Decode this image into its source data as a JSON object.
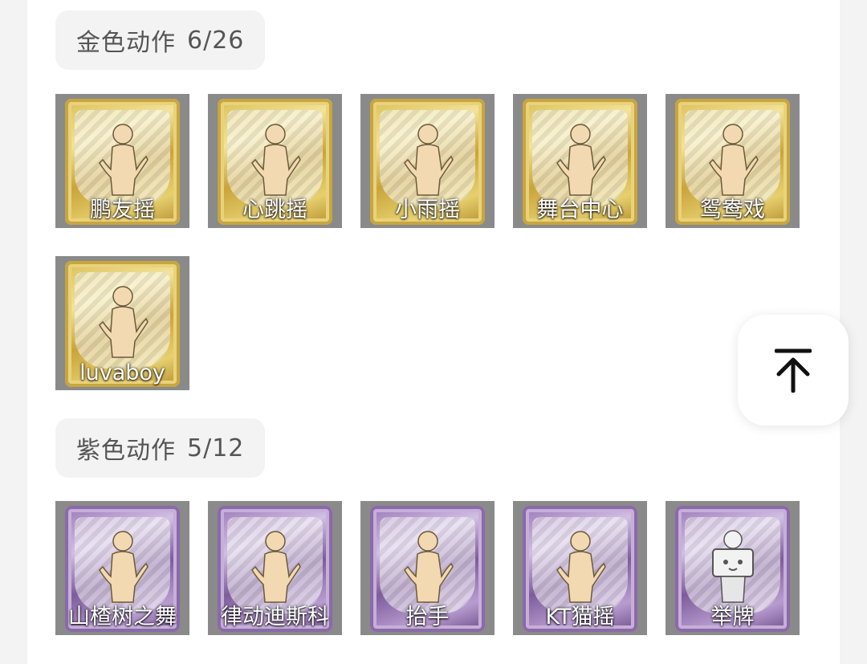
{
  "sections": [
    {
      "title": "金色动作",
      "count": "6/26",
      "tier": "gold",
      "items": [
        {
          "label": "鹏友摇",
          "icon": "dancer-icon"
        },
        {
          "label": "心跳摇",
          "icon": "dancer-icon"
        },
        {
          "label": "小雨摇",
          "icon": "dancer-icon"
        },
        {
          "label": "舞台中心",
          "icon": "dancer-icon"
        },
        {
          "label": "鸳鸯戏",
          "icon": "dancer-icon"
        },
        {
          "label": "luvaboy",
          "icon": "dancer-icon"
        }
      ]
    },
    {
      "title": "紫色动作",
      "count": "5/12",
      "tier": "purple",
      "items": [
        {
          "label": "山楂树之舞",
          "icon": "dancer-icon"
        },
        {
          "label": "律动迪斯科",
          "icon": "dancer-icon"
        },
        {
          "label": "抬手",
          "icon": "dancer-icon"
        },
        {
          "label": "KT猫摇",
          "icon": "dancer-icon"
        },
        {
          "label": "举牌",
          "icon": "sign-holder-icon"
        }
      ]
    }
  ],
  "scroll_top": {
    "icon": "arrow-up-to-top-icon"
  },
  "colors": {
    "gold": "#d9bf56",
    "purple": "#9a78b8",
    "figure": "#f2d9b1"
  }
}
